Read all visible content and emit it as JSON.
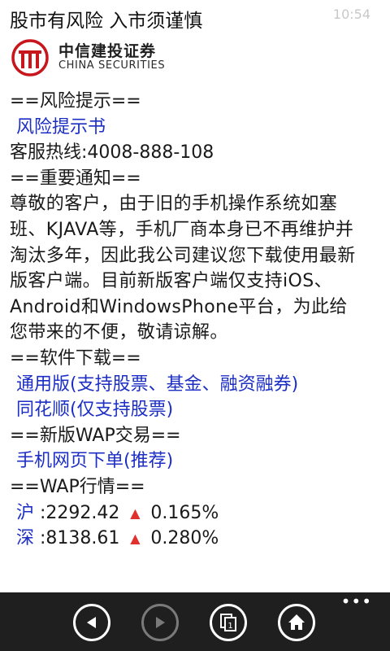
{
  "status": {
    "time": "10:54"
  },
  "header": {
    "title": "股市有风险 入市须谨慎"
  },
  "logo": {
    "name_cn": "中信建投证券",
    "name_en": "CHINA SECURITIES"
  },
  "sections": {
    "risk": {
      "heading": "==风险提示==",
      "link": "风险提示书",
      "hotline": "客服热线:4008-888-108"
    },
    "notice": {
      "heading": "==重要通知==",
      "body": "尊敬的客户，由于旧的手机操作系统如塞班、KJAVA等，手机厂商本身已不再维护并淘汰多年，因此我公司建议您下载使用最新版客户端。目前新版客户端仅支持iOS、Android和WindowsPhone平台，为此给您带来的不便，敬请谅解。"
    },
    "download": {
      "heading": "==软件下载==",
      "links": [
        "通用版(支持股票、基金、融资融券)",
        "同花顺(仅支持股票)"
      ]
    },
    "wap_trade": {
      "heading": "==新版WAP交易==",
      "link": "手机网页下单(推荐)"
    },
    "wap_quote": {
      "heading": "==WAP行情==",
      "quotes": [
        {
          "label": "沪",
          "value": ":2292.42",
          "change": "0.165%",
          "direction": "up"
        },
        {
          "label": "深",
          "value": ":8138.61",
          "change": "0.280%",
          "direction": "up"
        }
      ]
    }
  },
  "app_bar": {
    "buttons": [
      {
        "icon": "back-icon",
        "enabled": true
      },
      {
        "icon": "forward-icon",
        "enabled": false
      },
      {
        "icon": "tabs-icon",
        "tab_count": "1",
        "enabled": true
      },
      {
        "icon": "home-icon",
        "enabled": true
      }
    ],
    "more": "•••"
  },
  "colors": {
    "link": "#1c2ec4",
    "up": "#e0312e",
    "app_bar_bg": "#1f1f1f",
    "logo_red": "#c8161d"
  }
}
